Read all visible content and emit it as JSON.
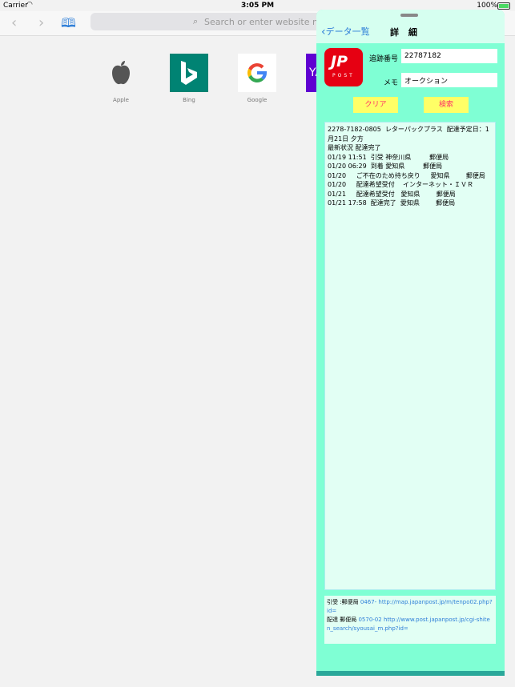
{
  "status": {
    "carrier": "Carrier",
    "time": "3:05 PM",
    "battery": "100%"
  },
  "browser": {
    "search_placeholder": "Search or enter website name"
  },
  "favorites": [
    {
      "label": "Apple"
    },
    {
      "label": "Bing"
    },
    {
      "label": "Google"
    },
    {
      "label": "YA"
    }
  ],
  "panel": {
    "back_label": "データ一覧",
    "title": "詳 細",
    "tracking_label": "追跡番号",
    "tracking_value": "22787182",
    "memo_label": "メモ",
    "memo_value": "オークション",
    "clear_button": "クリア",
    "search_button": "検索",
    "results": [
      "2278-7182-0805  レターパックプラス  配達予定日：1月21日 夕方",
      "最新状況 配達完了",
      "01/19 11:51  引受 神奈川県         郵便局",
      "01/20 06:29  到着 愛知県         郵便局",
      "01/20     ご不在のため持ち戻り     愛知県        郵便局",
      "01/20     配達希望受付    インターネット・ＩＶＲ",
      "01/21     配達希望受付   愛知県        郵便局",
      "01/21 17:58  配達完了  愛知県        郵便局"
    ],
    "links": {
      "line1_prefix": "引受       :郵便局",
      "line1_tel": "0467-",
      "line1_url": "http://map.japanpost.jp/m/tenpo02.php?id=",
      "line2_prefix": "配達      郵便局",
      "line2_tel": "0570-02",
      "line2_url": "http://www.post.japanpost.jp/cgi-shiten_search/syousai_m.php?id="
    }
  }
}
